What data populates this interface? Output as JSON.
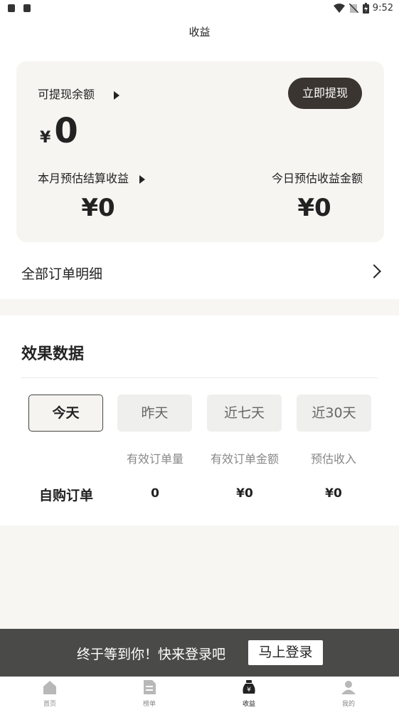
{
  "status_bar": {
    "time": "9:52"
  },
  "header": {
    "title": "收益"
  },
  "card": {
    "withdrawable_label": "可提现余额",
    "withdraw_button": "立即提现",
    "currency": "¥",
    "withdrawable_value": "0",
    "month_label": "本月预估结算收益",
    "today_label": "今日预估收益金额",
    "month_value": "¥0",
    "today_value": "¥0"
  },
  "orders": {
    "label": "全部订单明细"
  },
  "effect": {
    "title": "效果数据",
    "tabs": [
      "今天",
      "昨天",
      "近七天",
      "近30天"
    ],
    "active_tab": "今天",
    "columns": [
      "有效订单量",
      "有效订单金额",
      "预估收入"
    ],
    "rows": [
      {
        "label": "自购订单",
        "values": [
          "0",
          "¥0",
          "¥0"
        ]
      }
    ]
  },
  "banner": {
    "text": "终于等到你！快来登录吧",
    "login_button": "马上登录"
  },
  "tabbar": {
    "items": [
      {
        "label": "首页",
        "icon": "home-icon"
      },
      {
        "label": "榜单",
        "icon": "list-icon"
      },
      {
        "label": "收益",
        "icon": "money-bag-icon"
      },
      {
        "label": "我的",
        "icon": "user-icon"
      }
    ],
    "active": "收益"
  }
}
